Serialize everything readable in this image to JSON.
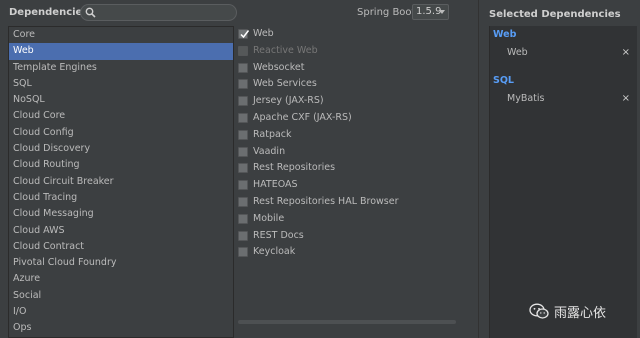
{
  "header": {
    "title": "Dependencies",
    "search_value": "",
    "boot_label": "Spring Boot",
    "boot_version": "1.5.9"
  },
  "categories": [
    {
      "label": "Core",
      "selected": false
    },
    {
      "label": "Web",
      "selected": true
    },
    {
      "label": "Template Engines",
      "selected": false
    },
    {
      "label": "SQL",
      "selected": false
    },
    {
      "label": "NoSQL",
      "selected": false
    },
    {
      "label": "Cloud Core",
      "selected": false
    },
    {
      "label": "Cloud Config",
      "selected": false
    },
    {
      "label": "Cloud Discovery",
      "selected": false
    },
    {
      "label": "Cloud Routing",
      "selected": false
    },
    {
      "label": "Cloud Circuit Breaker",
      "selected": false
    },
    {
      "label": "Cloud Tracing",
      "selected": false
    },
    {
      "label": "Cloud Messaging",
      "selected": false
    },
    {
      "label": "Cloud AWS",
      "selected": false
    },
    {
      "label": "Cloud Contract",
      "selected": false
    },
    {
      "label": "Pivotal Cloud Foundry",
      "selected": false
    },
    {
      "label": "Azure",
      "selected": false
    },
    {
      "label": "Social",
      "selected": false
    },
    {
      "label": "I/O",
      "selected": false
    },
    {
      "label": "Ops",
      "selected": false
    }
  ],
  "dependencies": [
    {
      "label": "Web",
      "checked": true,
      "disabled": false
    },
    {
      "label": "Reactive Web",
      "checked": false,
      "disabled": true
    },
    {
      "label": "Websocket",
      "checked": false,
      "disabled": false
    },
    {
      "label": "Web Services",
      "checked": false,
      "disabled": false
    },
    {
      "label": "Jersey (JAX-RS)",
      "checked": false,
      "disabled": false
    },
    {
      "label": "Apache CXF (JAX-RS)",
      "checked": false,
      "disabled": false
    },
    {
      "label": "Ratpack",
      "checked": false,
      "disabled": false
    },
    {
      "label": "Vaadin",
      "checked": false,
      "disabled": false
    },
    {
      "label": "Rest Repositories",
      "checked": false,
      "disabled": false
    },
    {
      "label": "HATEOAS",
      "checked": false,
      "disabled": false
    },
    {
      "label": "Rest Repositories HAL Browser",
      "checked": false,
      "disabled": false
    },
    {
      "label": "Mobile",
      "checked": false,
      "disabled": false
    },
    {
      "label": "REST Docs",
      "checked": false,
      "disabled": false
    },
    {
      "label": "Keycloak",
      "checked": false,
      "disabled": false
    }
  ],
  "selected_panel": {
    "title": "Selected Dependencies",
    "groups": [
      {
        "name": "Web",
        "items": [
          "Web"
        ]
      },
      {
        "name": "SQL",
        "items": [
          "MyBatis"
        ]
      }
    ],
    "remove_glyph": "×"
  },
  "watermark": {
    "text": "雨露心依",
    "icon": "wechat-icon"
  },
  "colors": {
    "background": "#3c3f41",
    "selection": "#4b6eaf",
    "group_accent": "#589df6",
    "panel": "#313335"
  }
}
